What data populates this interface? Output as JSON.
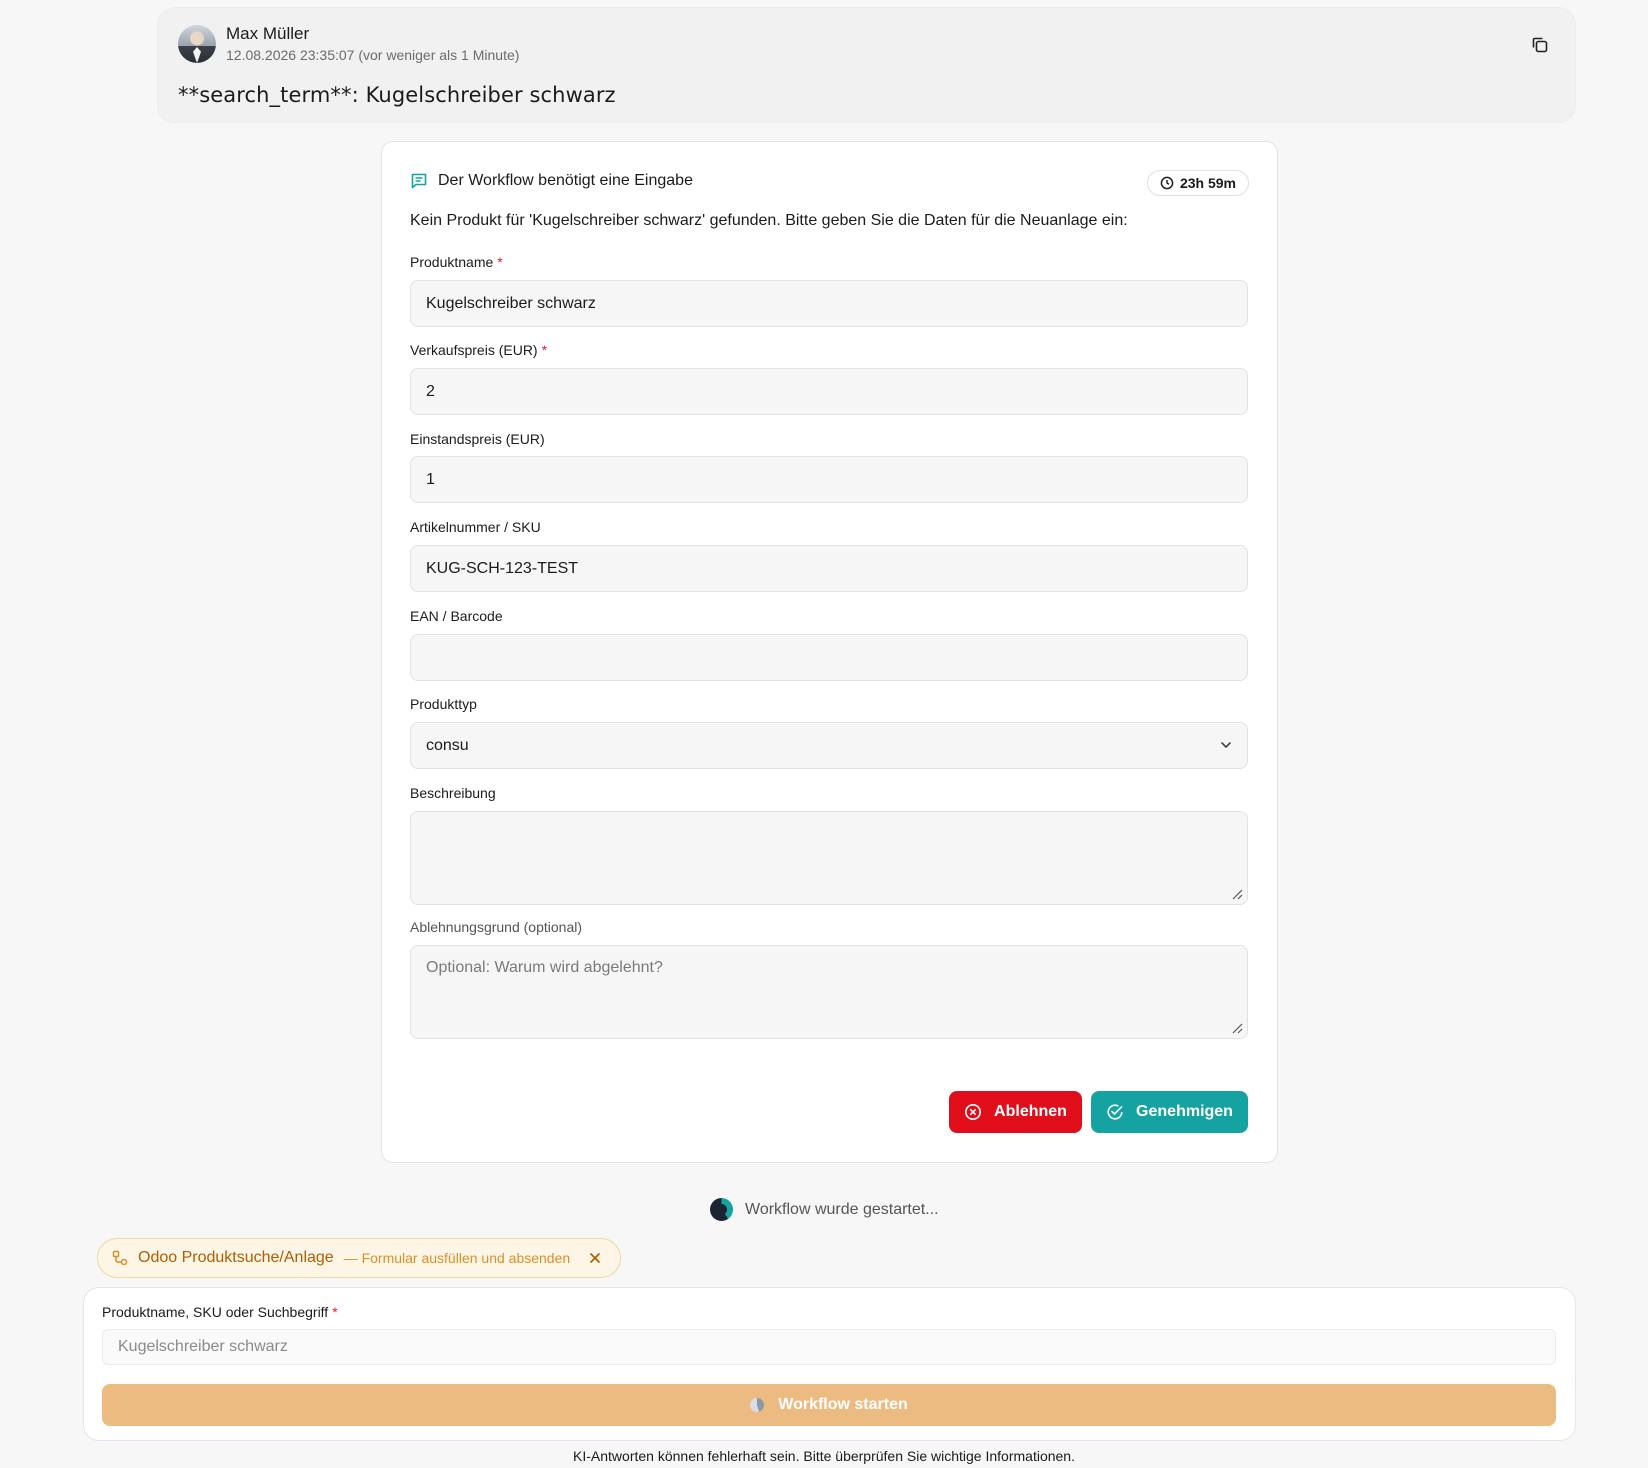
{
  "message": {
    "author": "Max Müller",
    "timestamp": "12.08.2026 23:35:07 (vor weniger als 1 Minute)",
    "text": "**search_term**: Kugelschreiber schwarz"
  },
  "workflow": {
    "heading": "Der Workflow benötigt eine Eingabe",
    "timer": "23h 59m",
    "description": "Kein Produkt für 'Kugelschreiber schwarz' gefunden. Bitte geben Sie die Daten für die Neuanlage ein:",
    "fields": {
      "product_name": {
        "label": "Produktname",
        "value": "Kugelschreiber schwarz",
        "required": "*"
      },
      "sale_price": {
        "label": "Verkaufspreis (EUR)",
        "value": "2",
        "required": "*"
      },
      "cost_price": {
        "label": "Einstandspreis (EUR)",
        "value": "1"
      },
      "sku": {
        "label": "Artikelnummer / SKU",
        "value": "KUG-SCH-123-TEST"
      },
      "ean": {
        "label": "EAN / Barcode",
        "value": ""
      },
      "product_type": {
        "label": "Produkttyp",
        "value": "consu"
      },
      "description": {
        "label": "Beschreibung",
        "value": ""
      },
      "reject_reason": {
        "label": "Ablehnungsgrund (optional)",
        "placeholder": "Optional: Warum wird abgelehnt?"
      }
    },
    "reject_label": "Ablehnen",
    "approve_label": "Genehmigen"
  },
  "status": {
    "text": "Workflow wurde gestartet..."
  },
  "chip": {
    "title": "Odoo Produktsuche/Anlage",
    "subtitle": "— Formular ausfüllen und absenden"
  },
  "bottom_form": {
    "label": "Produktname, SKU oder Suchbegriff",
    "required": "*",
    "placeholder": "Kugelschreiber schwarz",
    "start_label": "Workflow starten"
  },
  "disclaimer": "KI-Antworten können fehlerhaft sein. Bitte überprüfen Sie wichtige Informationen.",
  "colors": {
    "accent_teal": "#14a3a0",
    "reject_red": "#e00d1a",
    "chip_text": "#b25d00",
    "start_button": "#ecbb82"
  }
}
